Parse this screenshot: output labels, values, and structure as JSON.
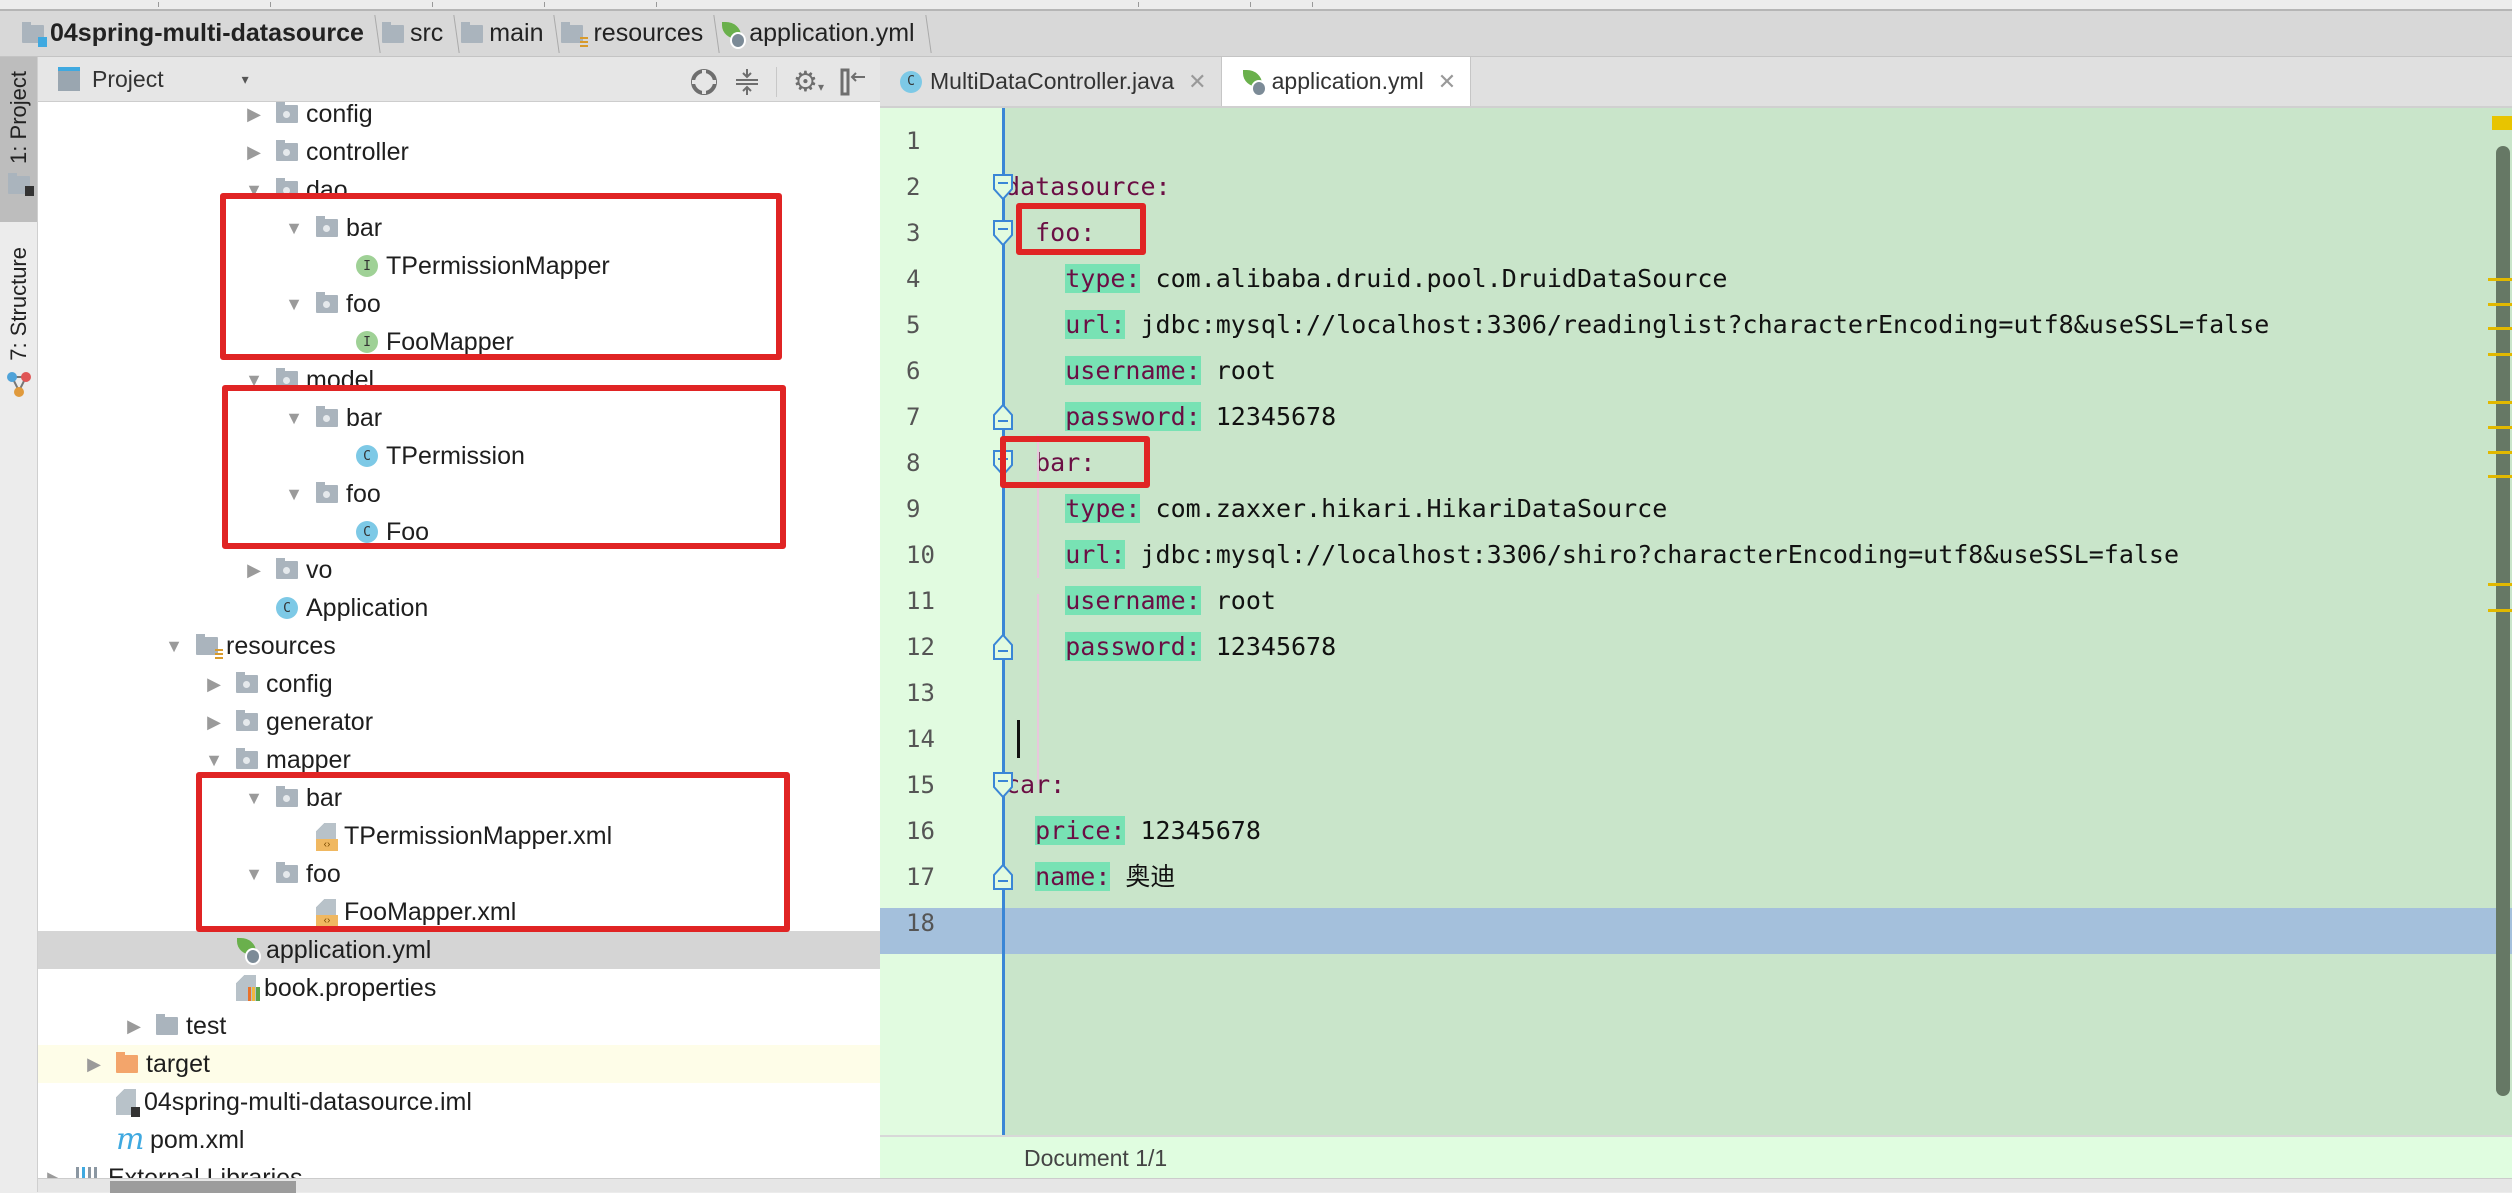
{
  "breadcrumb": [
    {
      "label": "04spring-multi-datasource",
      "icon": "module-folder-icon",
      "bold": true
    },
    {
      "label": "src",
      "icon": "folder-icon"
    },
    {
      "label": "main",
      "icon": "folder-icon"
    },
    {
      "label": "resources",
      "icon": "resources-folder-icon"
    },
    {
      "label": "application.yml",
      "icon": "spring-yml-icon"
    }
  ],
  "tool_strip": {
    "project_tab": "1: Project",
    "structure_tab": "7: Structure"
  },
  "project_panel": {
    "title": "Project",
    "dropdown_icon": "▾",
    "icons": [
      "locate-icon",
      "collapse-all-icon",
      "settings-icon",
      "hide-icon"
    ]
  },
  "tree": [
    {
      "label": "config",
      "icon": "package",
      "arrow": "▶",
      "indent": 4
    },
    {
      "label": "controller",
      "icon": "package",
      "arrow": "▶",
      "indent": 4
    },
    {
      "label": "dao",
      "icon": "package",
      "arrow": "▼",
      "indent": 4
    },
    {
      "label": "bar",
      "icon": "package",
      "arrow": "▼",
      "indent": 5
    },
    {
      "label": "TPermissionMapper",
      "icon": "interface",
      "arrow": "",
      "indent": 6
    },
    {
      "label": "foo",
      "icon": "package",
      "arrow": "▼",
      "indent": 5
    },
    {
      "label": "FooMapper",
      "icon": "interface",
      "arrow": "",
      "indent": 6
    },
    {
      "label": "model",
      "icon": "package",
      "arrow": "▼",
      "indent": 4
    },
    {
      "label": "bar",
      "icon": "package",
      "arrow": "▼",
      "indent": 5
    },
    {
      "label": "TPermission",
      "icon": "class",
      "arrow": "",
      "indent": 6
    },
    {
      "label": "foo",
      "icon": "package",
      "arrow": "▼",
      "indent": 5
    },
    {
      "label": "Foo",
      "icon": "class",
      "arrow": "",
      "indent": 6
    },
    {
      "label": "vo",
      "icon": "package",
      "arrow": "▶",
      "indent": 4
    },
    {
      "label": "Application",
      "icon": "spring-class",
      "arrow": "",
      "indent": 4
    },
    {
      "label": "resources",
      "icon": "resources",
      "arrow": "▼",
      "indent": 2
    },
    {
      "label": "config",
      "icon": "package",
      "arrow": "▶",
      "indent": 3
    },
    {
      "label": "generator",
      "icon": "package",
      "arrow": "▶",
      "indent": 3
    },
    {
      "label": "mapper",
      "icon": "package",
      "arrow": "▼",
      "indent": 3
    },
    {
      "label": "bar",
      "icon": "package",
      "arrow": "▼",
      "indent": 4
    },
    {
      "label": "TPermissionMapper.xml",
      "icon": "xml",
      "arrow": "",
      "indent": 5
    },
    {
      "label": "foo",
      "icon": "package",
      "arrow": "▼",
      "indent": 4
    },
    {
      "label": "FooMapper.xml",
      "icon": "xml",
      "arrow": "",
      "indent": 5
    },
    {
      "label": "application.yml",
      "icon": "spring-yml",
      "arrow": "",
      "indent": 3,
      "selected": true
    },
    {
      "label": "book.properties",
      "icon": "properties",
      "arrow": "",
      "indent": 3
    },
    {
      "label": "test",
      "icon": "folder",
      "arrow": "▶",
      "indent": 1
    },
    {
      "label": "target",
      "icon": "excluded-folder",
      "arrow": "▶",
      "indent": 0,
      "excluded": true
    },
    {
      "label": "04spring-multi-datasource.iml",
      "icon": "iml",
      "arrow": "",
      "indent": 0
    },
    {
      "label": "pom.xml",
      "icon": "maven",
      "arrow": "",
      "indent": 0
    },
    {
      "label": "External Libraries",
      "icon": "libraries",
      "arrow": "▶",
      "indent": -1
    }
  ],
  "editor_tabs": [
    {
      "label": "MultiDataController.java",
      "icon": "class",
      "active": false,
      "close": "✕"
    },
    {
      "label": "application.yml",
      "icon": "spring-yml",
      "active": true,
      "close": "✕"
    }
  ],
  "code_lines": [
    {
      "n": "1",
      "indent": "",
      "key": "",
      "value": ""
    },
    {
      "n": "2",
      "indent": "",
      "key": "datasource:",
      "value": "",
      "hl": false
    },
    {
      "n": "3",
      "indent": "  ",
      "key": "foo:",
      "value": "",
      "hl": false
    },
    {
      "n": "4",
      "indent": "    ",
      "key": "type:",
      "value": " com.alibaba.druid.pool.DruidDataSource",
      "hl": true
    },
    {
      "n": "5",
      "indent": "    ",
      "key": "url:",
      "value": " jdbc:mysql://localhost:3306/readinglist?characterEncoding=utf8&useSSL=false",
      "hl": true
    },
    {
      "n": "6",
      "indent": "    ",
      "key": "username:",
      "value": " root",
      "hl": true
    },
    {
      "n": "7",
      "indent": "    ",
      "key": "password:",
      "value": " 12345678",
      "hl": true
    },
    {
      "n": "8",
      "indent": "  ",
      "key": "bar:",
      "value": "",
      "hl": false
    },
    {
      "n": "9",
      "indent": "    ",
      "key": "type:",
      "value": " com.zaxxer.hikari.HikariDataSource",
      "hl": true
    },
    {
      "n": "10",
      "indent": "    ",
      "key": "url:",
      "value": " jdbc:mysql://localhost:3306/shiro?characterEncoding=utf8&useSSL=false",
      "hl": true
    },
    {
      "n": "11",
      "indent": "    ",
      "key": "username:",
      "value": " root",
      "hl": true
    },
    {
      "n": "12",
      "indent": "    ",
      "key": "password:",
      "value": " 12345678",
      "hl": true
    },
    {
      "n": "13",
      "indent": "",
      "key": "",
      "value": ""
    },
    {
      "n": "14",
      "indent": "",
      "key": "",
      "value": "",
      "caret": true
    },
    {
      "n": "15",
      "indent": "",
      "key": "car:",
      "value": "",
      "hl": false
    },
    {
      "n": "16",
      "indent": "  ",
      "key": "price:",
      "value": " 12345678",
      "hl": true
    },
    {
      "n": "17",
      "indent": "  ",
      "key": "name:",
      "value": " 奥迪",
      "hl": true
    },
    {
      "n": "18",
      "indent": "",
      "key": "",
      "value": ""
    }
  ],
  "status": {
    "text": "Document 1/1"
  },
  "colors": {
    "editor_bg": "#c9e5ca",
    "gutter_bg": "#e1fbe0",
    "key_color": "#6b0e44",
    "key_highlight": "#78e2b4",
    "caret_row": "#a4c0dc",
    "annotation_red": "#e02424",
    "fold_blue": "#3a86d6"
  }
}
